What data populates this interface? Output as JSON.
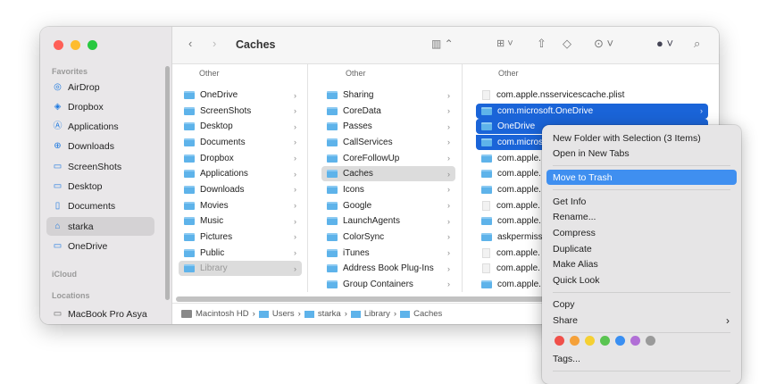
{
  "window": {
    "title": "Caches"
  },
  "sidebar": {
    "favorites_label": "Favorites",
    "icloud_label": "iCloud",
    "locations_label": "Locations",
    "items": [
      {
        "label": "AirDrop",
        "icon": "airdrop-icon"
      },
      {
        "label": "Dropbox",
        "icon": "dropbox-icon"
      },
      {
        "label": "Applications",
        "icon": "applications-icon"
      },
      {
        "label": "Downloads",
        "icon": "downloads-icon"
      },
      {
        "label": "ScreenShots",
        "icon": "folder-icon"
      },
      {
        "label": "Desktop",
        "icon": "desktop-icon"
      },
      {
        "label": "Documents",
        "icon": "document-icon"
      },
      {
        "label": "starka",
        "icon": "home-icon",
        "selected": true
      },
      {
        "label": "OneDrive",
        "icon": "folder-icon"
      }
    ],
    "locations": [
      {
        "label": "MacBook Pro Asya",
        "icon": "laptop-icon"
      }
    ]
  },
  "columns": [
    {
      "header": "Other",
      "rows": [
        {
          "n": "OneDrive",
          "f": 1,
          "c": 1
        },
        {
          "n": "ScreenShots",
          "f": 1,
          "c": 1
        },
        {
          "n": "Desktop",
          "f": 1,
          "c": 1
        },
        {
          "n": "Documents",
          "f": 1,
          "c": 1
        },
        {
          "n": "Dropbox",
          "f": 1,
          "c": 1
        },
        {
          "n": "Applications",
          "f": 1,
          "c": 1
        },
        {
          "n": "Downloads",
          "f": 1,
          "c": 1
        },
        {
          "n": "Movies",
          "f": 1,
          "c": 1
        },
        {
          "n": "Music",
          "f": 1,
          "c": 1
        },
        {
          "n": "Pictures",
          "f": 1,
          "c": 1
        },
        {
          "n": "Public",
          "f": 1,
          "c": 1
        },
        {
          "n": "Library",
          "f": 1,
          "c": 1,
          "s": "gray"
        }
      ]
    },
    {
      "header": "Other",
      "rows": [
        {
          "n": "Sharing",
          "f": 1,
          "c": 1
        },
        {
          "n": "CoreData",
          "f": 1,
          "c": 1
        },
        {
          "n": "Passes",
          "f": 1,
          "c": 1
        },
        {
          "n": "CallServices",
          "f": 1,
          "c": 1
        },
        {
          "n": "CoreFollowUp",
          "f": 1,
          "c": 1
        },
        {
          "n": "Caches",
          "f": 1,
          "c": 1,
          "s": "gsel"
        },
        {
          "n": "Icons",
          "f": 1,
          "c": 1
        },
        {
          "n": "Google",
          "f": 1,
          "c": 1
        },
        {
          "n": "LaunchAgents",
          "f": 1,
          "c": 1
        },
        {
          "n": "ColorSync",
          "f": 1,
          "c": 1
        },
        {
          "n": "iTunes",
          "f": 1,
          "c": 1
        },
        {
          "n": "Address Book Plug-Ins",
          "f": 1,
          "c": 1
        },
        {
          "n": "Group Containers",
          "f": 1,
          "c": 1
        }
      ]
    },
    {
      "header": "Other",
      "rows": [
        {
          "n": "com.apple.nsservicescache.plist",
          "f": 0
        },
        {
          "n": "com.microsoft.OneDrive",
          "f": 1,
          "c": 1,
          "s": "blue"
        },
        {
          "n": "OneDrive",
          "f": 1,
          "s": "blue"
        },
        {
          "n": "com.microsoft.OneDrive",
          "f": 1,
          "s": "blue"
        },
        {
          "n": "com.apple.",
          "f": 1
        },
        {
          "n": "com.apple.",
          "f": 1
        },
        {
          "n": "com.apple.",
          "f": 1
        },
        {
          "n": "com.apple.",
          "f": 0
        },
        {
          "n": "com.apple.",
          "f": 1
        },
        {
          "n": "askpermissiond",
          "f": 1
        },
        {
          "n": "com.apple.",
          "f": 0
        },
        {
          "n": "com.apple.",
          "f": 0
        },
        {
          "n": "com.apple.",
          "f": 1
        }
      ]
    }
  ],
  "pathbar": [
    "Macintosh HD",
    "Users",
    "starka",
    "Library",
    "Caches"
  ],
  "context_menu": {
    "groups": [
      [
        "New Folder with Selection (3 Items)",
        "Open in New Tabs"
      ],
      [
        "Move to Trash"
      ],
      [
        "Get Info",
        "Rename...",
        "Compress",
        "Duplicate",
        "Make Alias",
        "Quick Look"
      ],
      [
        "Copy",
        "Share"
      ]
    ],
    "highlighted": "Move to Trash",
    "tags_label": "Tags...",
    "tag_colors": [
      "#f0504a",
      "#f5a13a",
      "#f5d033",
      "#5ac451",
      "#3a8ff2",
      "#b16fd6",
      "#9a9a9a"
    ]
  }
}
